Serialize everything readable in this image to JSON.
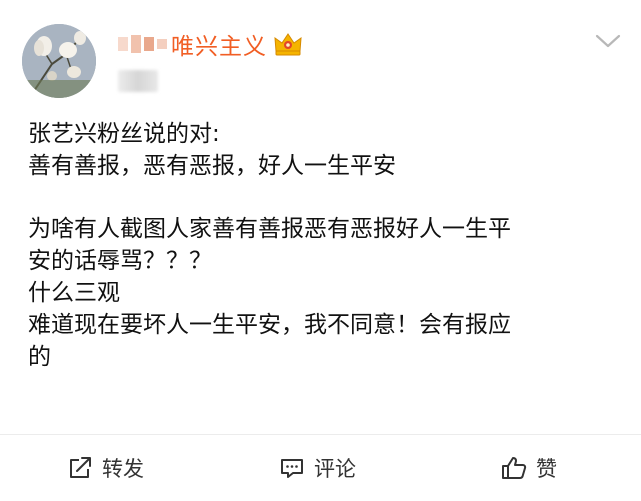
{
  "post": {
    "username": "唯兴主义",
    "lines": [
      "张艺兴粉丝说的对:",
      "善有善报，恶有恶报，好人一生平安",
      "",
      "为啥有人截图人家善有善报恶有恶报好人一生平",
      "安的话辱骂？？？",
      "什么三观",
      "难道现在要坏人一生平安，我不同意！会有报应",
      "的"
    ]
  },
  "actions": {
    "repost_label": "转发",
    "comment_label": "评论",
    "like_label": "赞"
  },
  "icons": {
    "avatar": "magnolia-flower-avatar",
    "badge": "crown-vip-icon",
    "menu": "chevron-down-icon",
    "repost": "repost-icon",
    "comment": "comment-icon",
    "like": "thumbs-up-icon"
  },
  "colors": {
    "username": "#f15e24",
    "badge_gold": "#f5b400",
    "badge_red": "#e2462b",
    "text": "#111111",
    "icon_gray": "#333333"
  }
}
